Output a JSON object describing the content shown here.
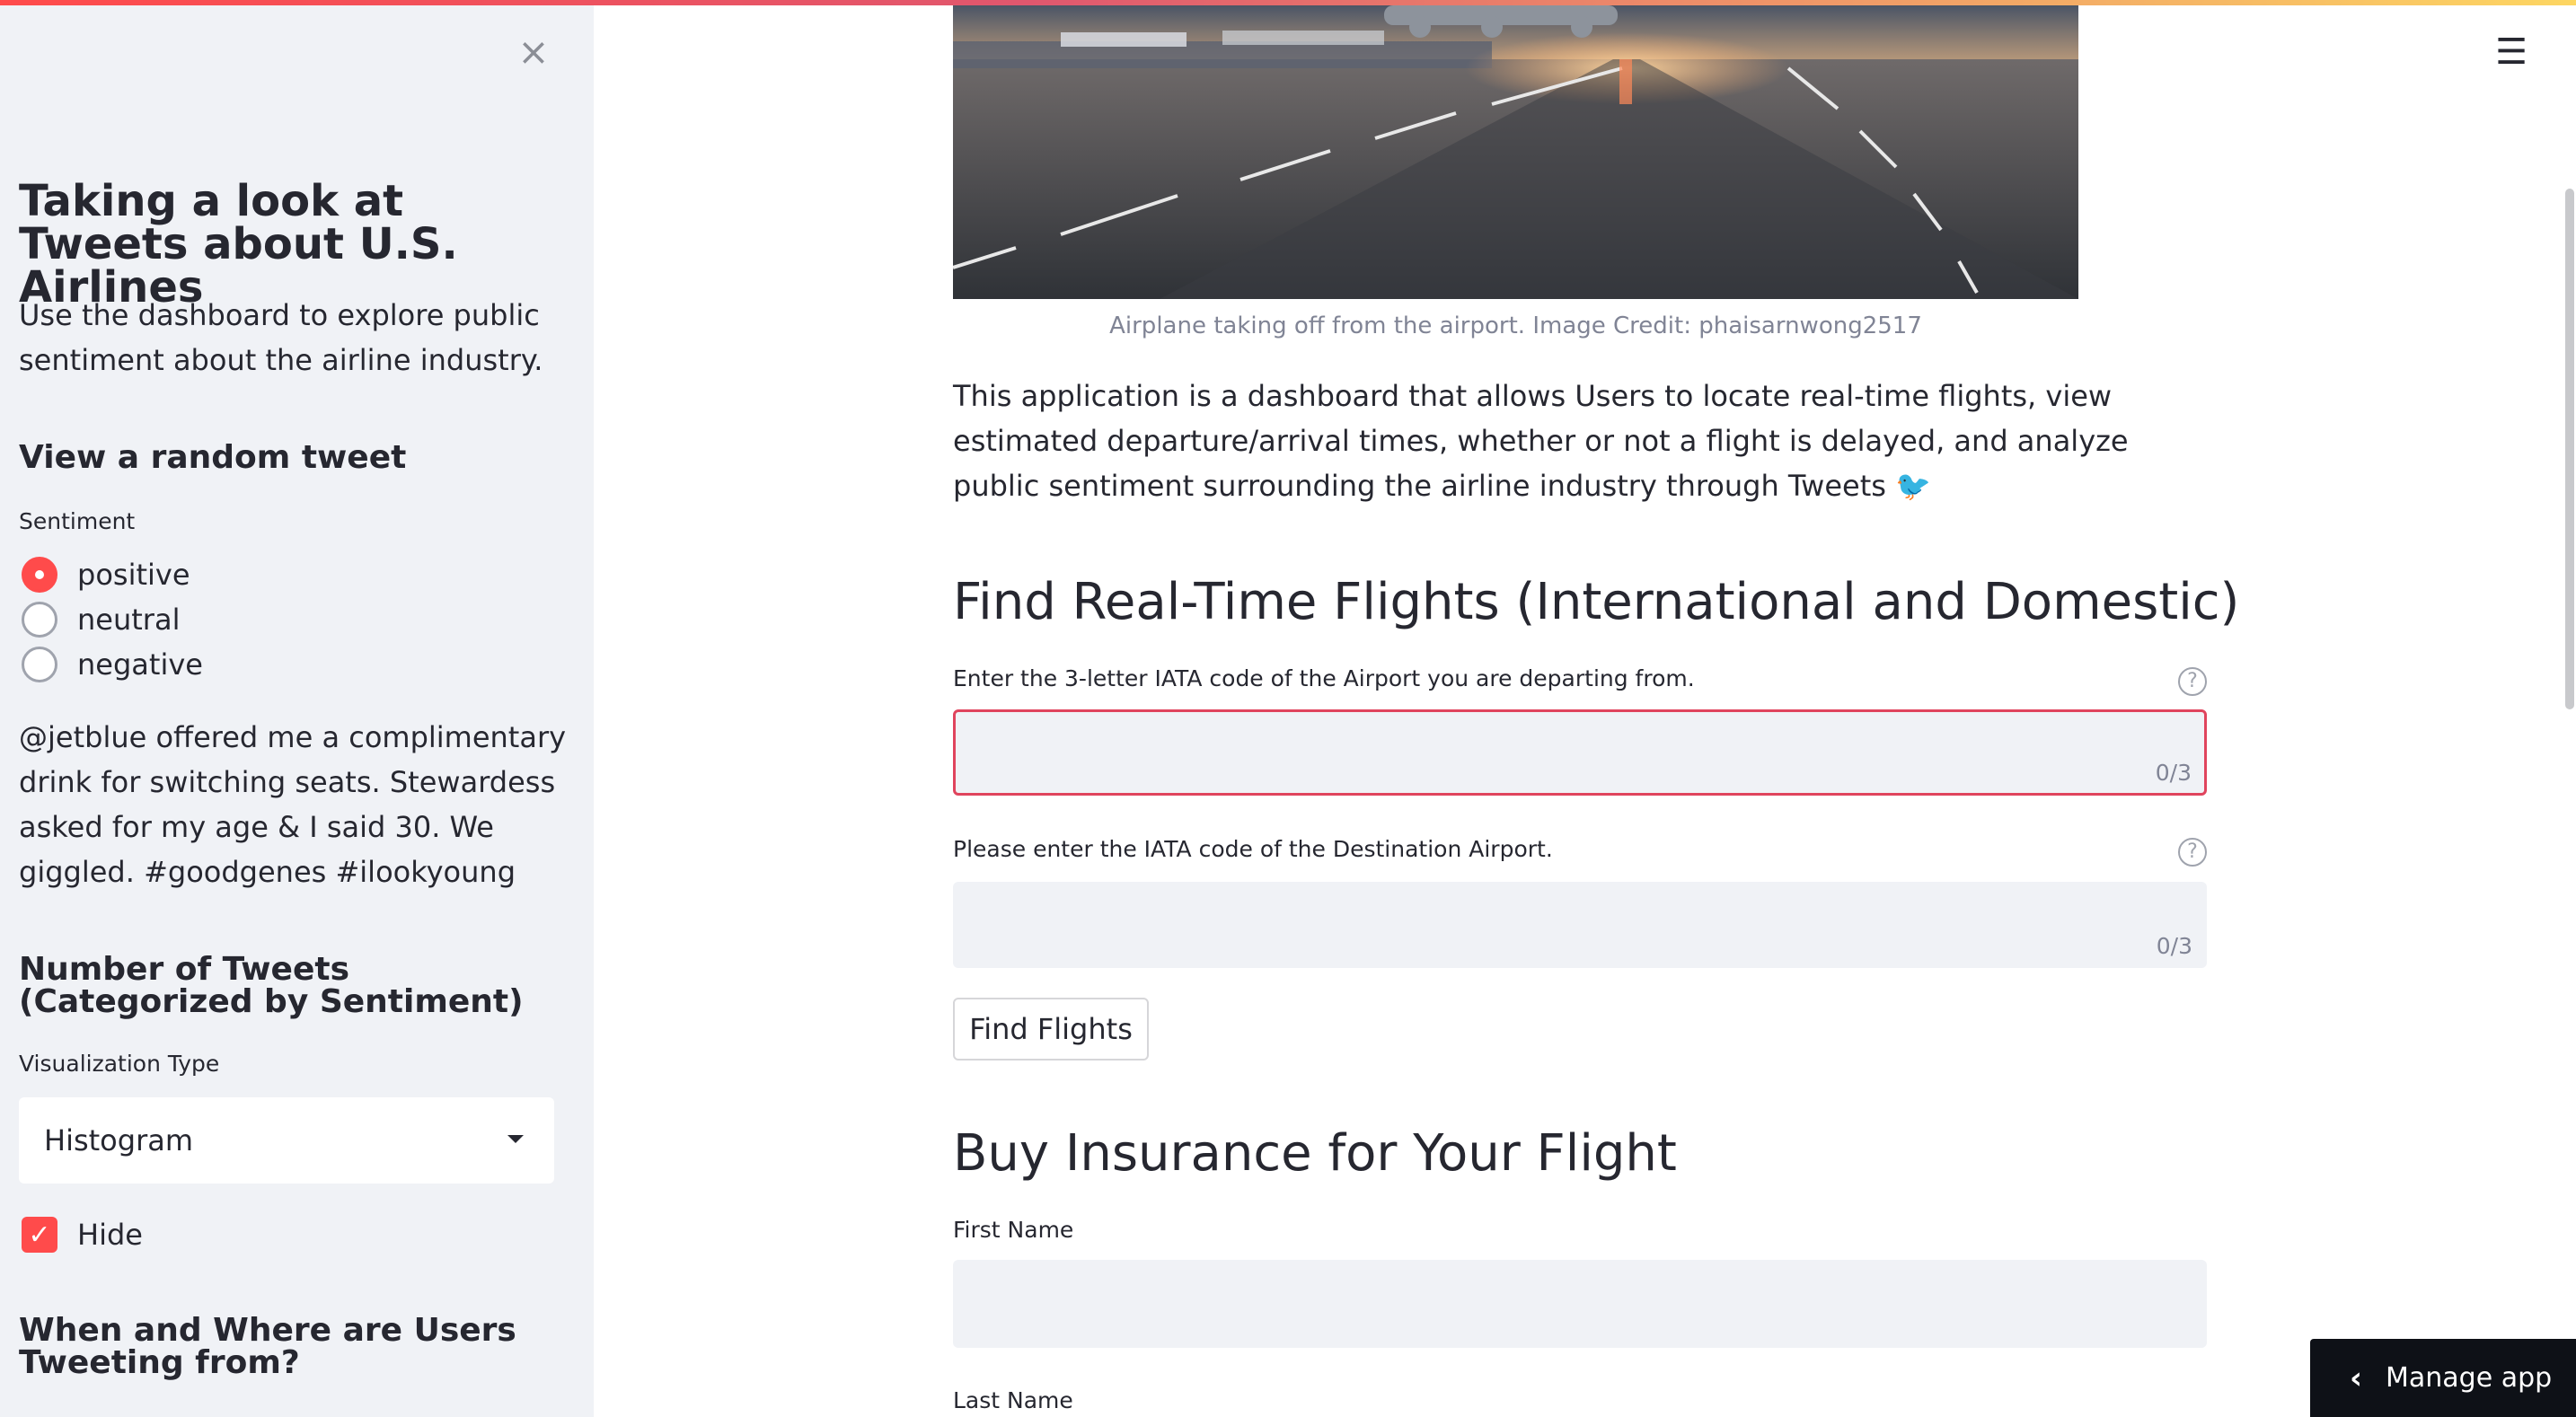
{
  "sidebar": {
    "title": "Taking a look at Tweets about U.S. Airlines",
    "description": "Use the dashboard to explore public sentiment about the airline industry.",
    "random_tweet_heading": "View a random tweet",
    "sentiment_label": "Sentiment",
    "sentiment_options": [
      "positive",
      "neutral",
      "negative"
    ],
    "sentiment_selected": "positive",
    "tweet_text": "@jetblue offered me a complimentary drink for switching seats. Stewardess asked for my age & I said 30. We giggled. #goodgenes #ilookyoung",
    "count_heading": "Number of Tweets (Categorized by Sentiment)",
    "viz_label": "Visualization Type",
    "viz_value": "Histogram",
    "hide_label": "Hide",
    "hide_checked": true,
    "where_heading": "When and Where are Users Tweeting from?"
  },
  "icons": {
    "close": "close-icon",
    "menu": "hamburger-menu-icon",
    "help": "help-circle-icon",
    "chevron": "chevron-left-icon"
  },
  "main": {
    "image_caption": "Airplane taking off from the airport. Image Credit: phaisarnwong2517",
    "intro": "This application is a dashboard that allows Users to locate real-time flights, view estimated departure/arrival times, whether or not a flight is delayed, and analyze public sentiment surrounding the airline industry through Tweets 🐦",
    "flights_heading": "Find Real-Time Flights (International and Domestic)",
    "departure_label": "Enter the 3-letter IATA code of the Airport you are departing from.",
    "departure_value": "",
    "departure_counter": "0/3",
    "destination_label": "Please enter the IATA code of the Destination Airport.",
    "destination_value": "",
    "destination_counter": "0/3",
    "find_button": "Find Flights",
    "insurance_heading": "Buy Insurance for Your Flight",
    "first_name_label": "First Name",
    "first_name_value": "",
    "last_name_label": "Last Name"
  },
  "manage_app_label": "Manage app",
  "colors": {
    "accent": "#ff4b4b",
    "focus_border": "#e0445d",
    "sidebar_bg": "#f0f2f6",
    "input_bg": "#f0f2f6",
    "text": "#262730",
    "muted": "#808495",
    "manage_bg": "#0e1117"
  }
}
